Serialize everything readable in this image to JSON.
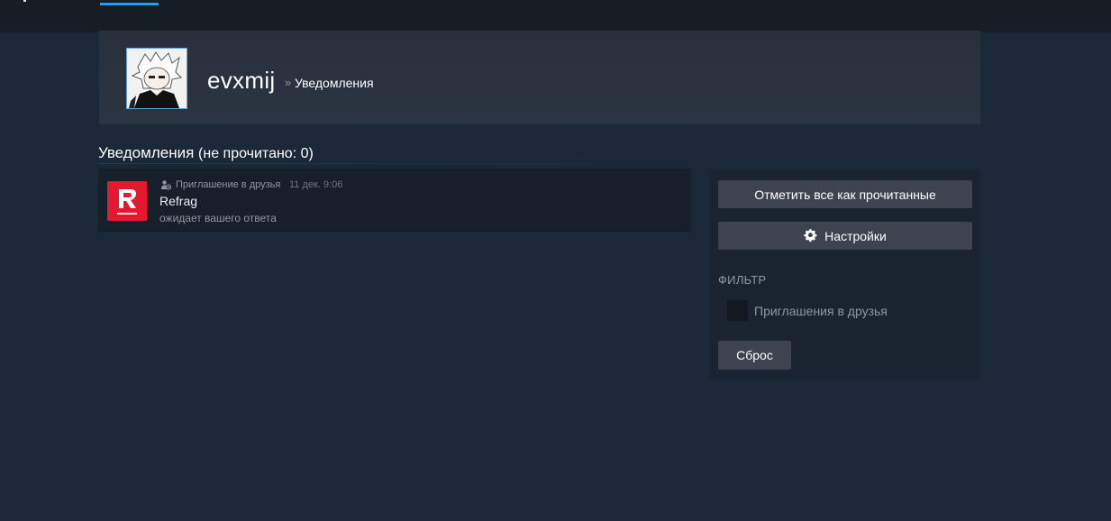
{
  "header": {
    "profile_name": "evxmij",
    "breadcrumb_separator": "»",
    "breadcrumb_page": "Уведомления"
  },
  "section": {
    "title": "Уведомления",
    "unread_label": "(не прочитано: 0)"
  },
  "notifications": [
    {
      "type_label": "Приглашение в друзья",
      "time": "11 дек. 9:06",
      "name": "Refrag",
      "status": "ожидает вашего ответа",
      "logo_color": "#e4192f",
      "icon": "friend-invite-icon"
    }
  ],
  "sidebar": {
    "mark_all_label": "Отметить все как прочитанные",
    "settings_label": "Настройки",
    "filter_heading": "ФИЛЬТР",
    "filter_option_label": "Приглашения в друзья",
    "filter_option_checked": false,
    "reset_label": "Сброс"
  },
  "colors": {
    "background": "#1b2838",
    "topbar": "#171d25",
    "accent": "#1a9fff",
    "button": "#3d4450"
  }
}
